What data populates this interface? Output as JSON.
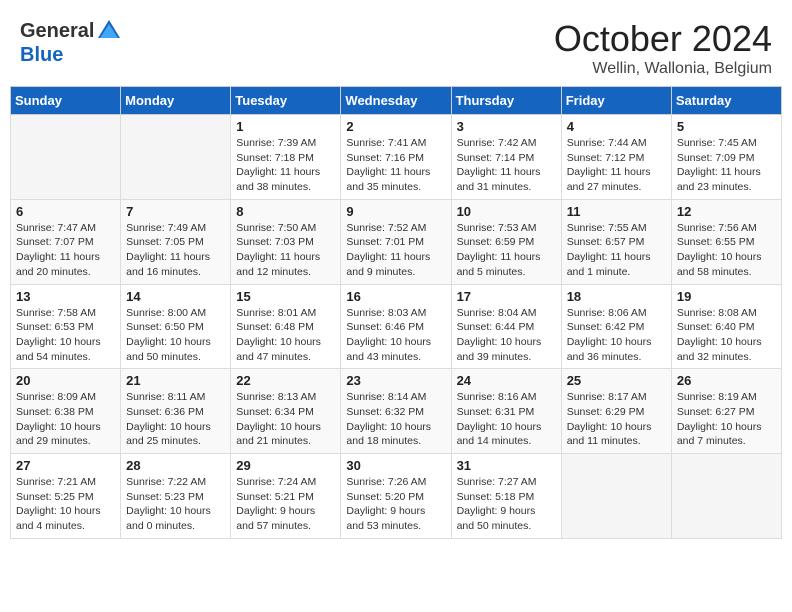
{
  "header": {
    "logo_general": "General",
    "logo_blue": "Blue",
    "main_title": "October 2024",
    "subtitle": "Wellin, Wallonia, Belgium"
  },
  "calendar": {
    "days_of_week": [
      "Sunday",
      "Monday",
      "Tuesday",
      "Wednesday",
      "Thursday",
      "Friday",
      "Saturday"
    ],
    "weeks": [
      [
        {
          "day": "",
          "sunrise": "",
          "sunset": "",
          "daylight": ""
        },
        {
          "day": "",
          "sunrise": "",
          "sunset": "",
          "daylight": ""
        },
        {
          "day": "1",
          "sunrise": "Sunrise: 7:39 AM",
          "sunset": "Sunset: 7:18 PM",
          "daylight": "Daylight: 11 hours and 38 minutes."
        },
        {
          "day": "2",
          "sunrise": "Sunrise: 7:41 AM",
          "sunset": "Sunset: 7:16 PM",
          "daylight": "Daylight: 11 hours and 35 minutes."
        },
        {
          "day": "3",
          "sunrise": "Sunrise: 7:42 AM",
          "sunset": "Sunset: 7:14 PM",
          "daylight": "Daylight: 11 hours and 31 minutes."
        },
        {
          "day": "4",
          "sunrise": "Sunrise: 7:44 AM",
          "sunset": "Sunset: 7:12 PM",
          "daylight": "Daylight: 11 hours and 27 minutes."
        },
        {
          "day": "5",
          "sunrise": "Sunrise: 7:45 AM",
          "sunset": "Sunset: 7:09 PM",
          "daylight": "Daylight: 11 hours and 23 minutes."
        }
      ],
      [
        {
          "day": "6",
          "sunrise": "Sunrise: 7:47 AM",
          "sunset": "Sunset: 7:07 PM",
          "daylight": "Daylight: 11 hours and 20 minutes."
        },
        {
          "day": "7",
          "sunrise": "Sunrise: 7:49 AM",
          "sunset": "Sunset: 7:05 PM",
          "daylight": "Daylight: 11 hours and 16 minutes."
        },
        {
          "day": "8",
          "sunrise": "Sunrise: 7:50 AM",
          "sunset": "Sunset: 7:03 PM",
          "daylight": "Daylight: 11 hours and 12 minutes."
        },
        {
          "day": "9",
          "sunrise": "Sunrise: 7:52 AM",
          "sunset": "Sunset: 7:01 PM",
          "daylight": "Daylight: 11 hours and 9 minutes."
        },
        {
          "day": "10",
          "sunrise": "Sunrise: 7:53 AM",
          "sunset": "Sunset: 6:59 PM",
          "daylight": "Daylight: 11 hours and 5 minutes."
        },
        {
          "day": "11",
          "sunrise": "Sunrise: 7:55 AM",
          "sunset": "Sunset: 6:57 PM",
          "daylight": "Daylight: 11 hours and 1 minute."
        },
        {
          "day": "12",
          "sunrise": "Sunrise: 7:56 AM",
          "sunset": "Sunset: 6:55 PM",
          "daylight": "Daylight: 10 hours and 58 minutes."
        }
      ],
      [
        {
          "day": "13",
          "sunrise": "Sunrise: 7:58 AM",
          "sunset": "Sunset: 6:53 PM",
          "daylight": "Daylight: 10 hours and 54 minutes."
        },
        {
          "day": "14",
          "sunrise": "Sunrise: 8:00 AM",
          "sunset": "Sunset: 6:50 PM",
          "daylight": "Daylight: 10 hours and 50 minutes."
        },
        {
          "day": "15",
          "sunrise": "Sunrise: 8:01 AM",
          "sunset": "Sunset: 6:48 PM",
          "daylight": "Daylight: 10 hours and 47 minutes."
        },
        {
          "day": "16",
          "sunrise": "Sunrise: 8:03 AM",
          "sunset": "Sunset: 6:46 PM",
          "daylight": "Daylight: 10 hours and 43 minutes."
        },
        {
          "day": "17",
          "sunrise": "Sunrise: 8:04 AM",
          "sunset": "Sunset: 6:44 PM",
          "daylight": "Daylight: 10 hours and 39 minutes."
        },
        {
          "day": "18",
          "sunrise": "Sunrise: 8:06 AM",
          "sunset": "Sunset: 6:42 PM",
          "daylight": "Daylight: 10 hours and 36 minutes."
        },
        {
          "day": "19",
          "sunrise": "Sunrise: 8:08 AM",
          "sunset": "Sunset: 6:40 PM",
          "daylight": "Daylight: 10 hours and 32 minutes."
        }
      ],
      [
        {
          "day": "20",
          "sunrise": "Sunrise: 8:09 AM",
          "sunset": "Sunset: 6:38 PM",
          "daylight": "Daylight: 10 hours and 29 minutes."
        },
        {
          "day": "21",
          "sunrise": "Sunrise: 8:11 AM",
          "sunset": "Sunset: 6:36 PM",
          "daylight": "Daylight: 10 hours and 25 minutes."
        },
        {
          "day": "22",
          "sunrise": "Sunrise: 8:13 AM",
          "sunset": "Sunset: 6:34 PM",
          "daylight": "Daylight: 10 hours and 21 minutes."
        },
        {
          "day": "23",
          "sunrise": "Sunrise: 8:14 AM",
          "sunset": "Sunset: 6:32 PM",
          "daylight": "Daylight: 10 hours and 18 minutes."
        },
        {
          "day": "24",
          "sunrise": "Sunrise: 8:16 AM",
          "sunset": "Sunset: 6:31 PM",
          "daylight": "Daylight: 10 hours and 14 minutes."
        },
        {
          "day": "25",
          "sunrise": "Sunrise: 8:17 AM",
          "sunset": "Sunset: 6:29 PM",
          "daylight": "Daylight: 10 hours and 11 minutes."
        },
        {
          "day": "26",
          "sunrise": "Sunrise: 8:19 AM",
          "sunset": "Sunset: 6:27 PM",
          "daylight": "Daylight: 10 hours and 7 minutes."
        }
      ],
      [
        {
          "day": "27",
          "sunrise": "Sunrise: 7:21 AM",
          "sunset": "Sunset: 5:25 PM",
          "daylight": "Daylight: 10 hours and 4 minutes."
        },
        {
          "day": "28",
          "sunrise": "Sunrise: 7:22 AM",
          "sunset": "Sunset: 5:23 PM",
          "daylight": "Daylight: 10 hours and 0 minutes."
        },
        {
          "day": "29",
          "sunrise": "Sunrise: 7:24 AM",
          "sunset": "Sunset: 5:21 PM",
          "daylight": "Daylight: 9 hours and 57 minutes."
        },
        {
          "day": "30",
          "sunrise": "Sunrise: 7:26 AM",
          "sunset": "Sunset: 5:20 PM",
          "daylight": "Daylight: 9 hours and 53 minutes."
        },
        {
          "day": "31",
          "sunrise": "Sunrise: 7:27 AM",
          "sunset": "Sunset: 5:18 PM",
          "daylight": "Daylight: 9 hours and 50 minutes."
        },
        {
          "day": "",
          "sunrise": "",
          "sunset": "",
          "daylight": ""
        },
        {
          "day": "",
          "sunrise": "",
          "sunset": "",
          "daylight": ""
        }
      ]
    ]
  }
}
